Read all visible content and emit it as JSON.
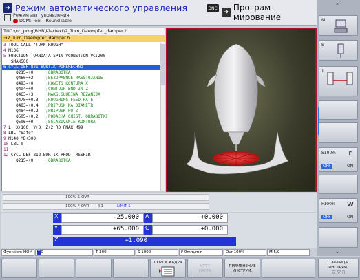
{
  "header": {
    "mode_title": "Режим автоматического управления",
    "mode_sub1": "Режим авт. управления",
    "mode_sub2": "DCM: Tool - RoundTable",
    "dnc": "DNC",
    "prog_title": "Програм- мирование"
  },
  "program": {
    "path": "TNC:\\nc_prog\\BHB\\Klartext\\2_Turn_Daempfer_damper.h",
    "name": "→2_Turn_Daempfer_damper.h",
    "lines": [
      {
        "n": "3",
        "t": "TOOL CALL \"TURN_ROUGH\"",
        "c": ""
      },
      {
        "n": "4",
        "t": "M136",
        "c": ""
      },
      {
        "n": "5",
        "t": "FUNCTION TURNDATA SPIN VCONST:ON VC:200",
        "c": ""
      },
      {
        "n": "",
        "t": "  SMAX500",
        "c": ""
      },
      {
        "n": "6",
        "t": "CYCL DEF 821 BURTIK POPERECHNO",
        "c": "",
        "sel": true
      },
      {
        "n": "",
        "t": "    Q215=+0     ",
        "c": ";OBRABOTKA"
      },
      {
        "n": "",
        "t": "    Q460=+2     ",
        "c": ";BEZOPASNOE RASSTOJANIE"
      },
      {
        "n": "",
        "t": "    Q493=+0     ",
        "c": ";KONETS KONTURA X"
      },
      {
        "n": "",
        "t": "    Q494=+0     ",
        "c": ";CONTOUR END IN Z"
      },
      {
        "n": "",
        "t": "    Q463=+3     ",
        "c": ";MAKS.GLUBINA REZANIJA"
      },
      {
        "n": "",
        "t": "    Q478=+0.3   ",
        "c": ";ROUGHING FEED RATE"
      },
      {
        "n": "",
        "t": "    Q483=+0.4   ",
        "c": ";PRIPUSK NA DIAMETR"
      },
      {
        "n": "",
        "t": "    Q484=+0.2   ",
        "c": ";PRIPUSK PO Z"
      },
      {
        "n": "",
        "t": "    Q505=+0.2   ",
        "c": ";PODACHA CHIST. OBRABOTKI"
      },
      {
        "n": "",
        "t": "    Q506=+0     ",
        "c": ";SGLAZIVANIE KONTURA"
      },
      {
        "n": "7",
        "t": "L  X+100  Y+0  Z+2 R0 FMAX M99",
        "c": ""
      },
      {
        "n": "8",
        "t": "LBL \"Safe\"",
        "c": ""
      },
      {
        "n": "9",
        "t": "M140 MB+300",
        "c": ""
      },
      {
        "n": "10",
        "t": "LBL 0",
        "c": ""
      },
      {
        "n": "11",
        "t": ";",
        "c": ""
      },
      {
        "n": "12",
        "t": "CYCL DEF 812 BURTIK PROD. RSSHIR.",
        "c": ""
      },
      {
        "n": "",
        "t": "    Q215=+0     ",
        "c": ";OBRABOTKA"
      }
    ]
  },
  "feed": {
    "s_ovr": "100% S-OVR",
    "f_ovr": "100% F-OVR",
    "s1": "S1",
    "limit": "LIMIT 1"
  },
  "axes": {
    "x_label": "X",
    "x_value": "-25.000",
    "a_label": "A",
    "a_value": "+0.000",
    "y_label": "Y",
    "y_value": "+65.000",
    "c_label": "C",
    "c_value": "+0.000",
    "z_label": "Z",
    "z_value": "+1.090"
  },
  "funcline": {
    "func": "Функtion: HOM",
    "t0": "0",
    "tool": "T 300",
    "s": "S 1000",
    "f": "F 0mm/min",
    "ovr": "Ovr 100%",
    "m": "M 5/9"
  },
  "right": {
    "s_pct": "S100%",
    "f_pct": "F100%",
    "off": "OFF",
    "on": "ON"
  },
  "softkeys": {
    "search": "ПОИСК КАДРА",
    "cut1": "КУТТ",
    "cut2": "ПАРТА",
    "apply1": "ПРИМЕНЕНИЕ",
    "apply2": "ИНСТРУМ.",
    "table1": "ТАБЛИЦА",
    "table2": "ИНСТРУМ."
  }
}
